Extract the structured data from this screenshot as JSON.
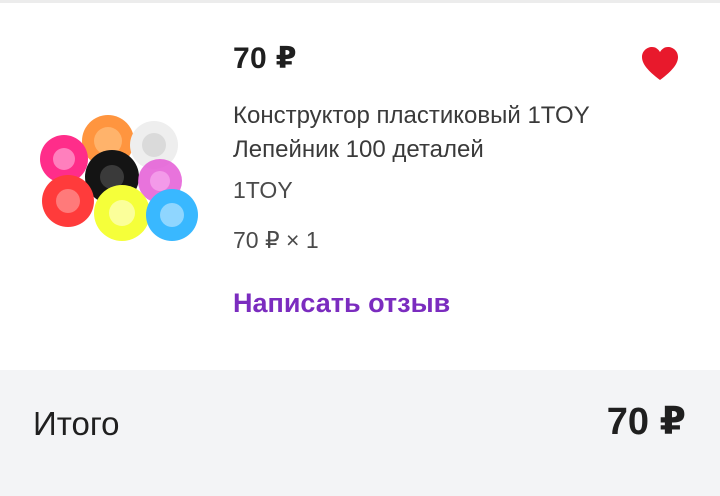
{
  "product": {
    "price": "70 ₽",
    "title": "Конструктор пластиковый 1TOY Лепейник 100 деталей",
    "brand": "1TOY",
    "quantity_line": "70 ₽ × 1",
    "review_label": "Написать отзыв",
    "favorite_icon": "heart-icon",
    "favorite_color": "#e8192c",
    "link_color": "#7b2cbf",
    "image_description_colors": [
      "#ff8a2a",
      "#f2f2f2",
      "#ff2d8a",
      "#111111",
      "#ff3b3b",
      "#e45bd6",
      "#f5ff3a",
      "#39b8ff"
    ]
  },
  "summary": {
    "total_label": "Итого",
    "total_value": "70 ₽"
  }
}
